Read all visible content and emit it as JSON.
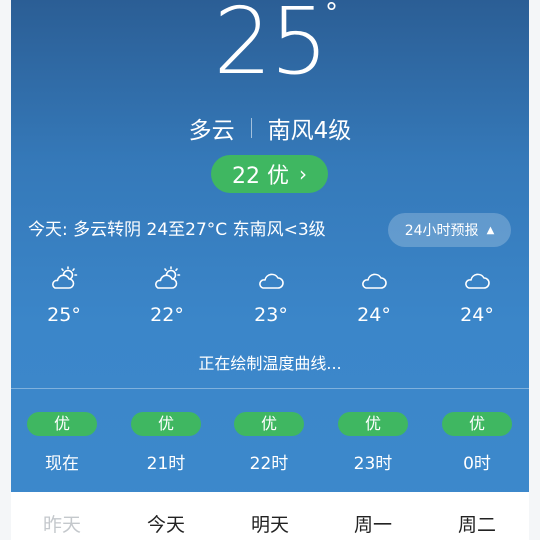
{
  "current": {
    "temperature": "25",
    "degree_symbol": "°",
    "condition": "多云",
    "wind": "南风4级"
  },
  "aqi": {
    "value_label": "22 优",
    "chevron": "›"
  },
  "today": {
    "summary": "今天: 多云转阴  24至27°C  东南风<3级"
  },
  "hourly_button": {
    "label": "24小时预报",
    "icon": "triangle-up-icon"
  },
  "forecast": [
    {
      "icon": "partly-cloudy-sun-icon",
      "temp": "25°"
    },
    {
      "icon": "partly-cloudy-sun-icon",
      "temp": "22°"
    },
    {
      "icon": "cloud-icon",
      "temp": "23°"
    },
    {
      "icon": "cloud-icon",
      "temp": "24°"
    },
    {
      "icon": "cloud-icon",
      "temp": "24°"
    }
  ],
  "drawing_status": "正在绘制温度曲线...",
  "aqi_hours": [
    {
      "badge": "优",
      "label": "现在"
    },
    {
      "badge": "优",
      "label": "21时"
    },
    {
      "badge": "优",
      "label": "22时"
    },
    {
      "badge": "优",
      "label": "23时"
    },
    {
      "badge": "优",
      "label": "0时"
    }
  ],
  "day_tabs": [
    "昨天",
    "今天",
    "明天",
    "周一",
    "周二"
  ],
  "colors": {
    "background_top": "#2b5e95",
    "background_bottom": "#3d89cc",
    "aqi_good": "#3fb761",
    "tab_muted": "#c4c8cc"
  }
}
